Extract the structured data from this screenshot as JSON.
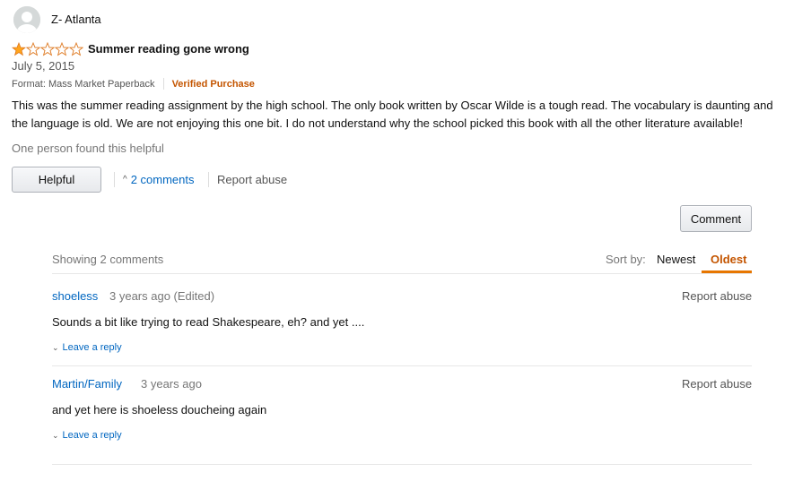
{
  "review": {
    "reviewer_name": "Z- Atlanta",
    "rating": 1,
    "max_rating": 5,
    "title": "Summer reading gone wrong",
    "date": "July 5, 2015",
    "format": "Format: Mass Market Paperback",
    "verified": "Verified Purchase",
    "body": "This was the summer reading assignment by the high school. The only book written by Oscar Wilde is a tough read. The vocabulary is daunting and the language is old. We are not enjoying this one bit. I do not understand why the school picked this book with all the other literature available!",
    "helpful_count_text": "One person found this helpful",
    "helpful_button": "Helpful",
    "comments_toggle": "2 comments",
    "report_abuse": "Report abuse"
  },
  "comments_section": {
    "comment_button": "Comment",
    "showing": "Showing 2 comments",
    "sort_by_label": "Sort by:",
    "sort_options": [
      "Newest",
      "Oldest"
    ],
    "sort_selected": "Oldest",
    "comments": [
      {
        "author": "shoeless",
        "time": "3 years ago (Edited)",
        "text": "Sounds a bit like trying to read Shakespeare, eh? and yet ....",
        "reply_label": "Leave a reply",
        "report_label": "Report abuse"
      },
      {
        "author": "Martin/Family",
        "time": "3 years ago",
        "text": "and yet here is shoeless doucheing again",
        "reply_label": "Leave a reply",
        "report_label": "Report abuse"
      }
    ]
  },
  "colors": {
    "star_fill": "#ffa41c",
    "link": "#0066c0",
    "accent": "#c45500"
  }
}
